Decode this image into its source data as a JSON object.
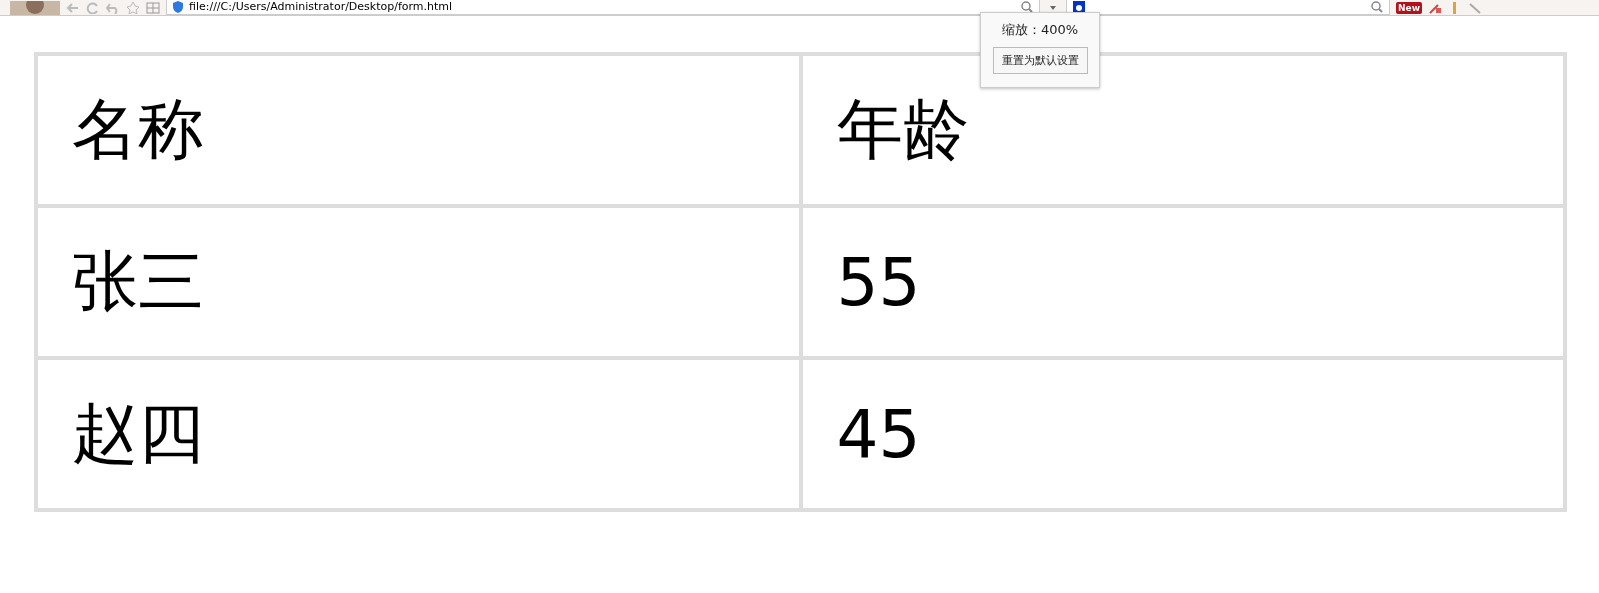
{
  "toolbar": {
    "address": "file:///C:/Users/Administrator/Desktop/form.html",
    "badge": "New"
  },
  "zoom_popup": {
    "label": "缩放：400%",
    "button": "重置为默认设置"
  },
  "table": {
    "columns": [
      "名称",
      "年龄"
    ],
    "rows": [
      [
        "张三",
        "55"
      ],
      [
        "赵四",
        "45"
      ]
    ]
  }
}
